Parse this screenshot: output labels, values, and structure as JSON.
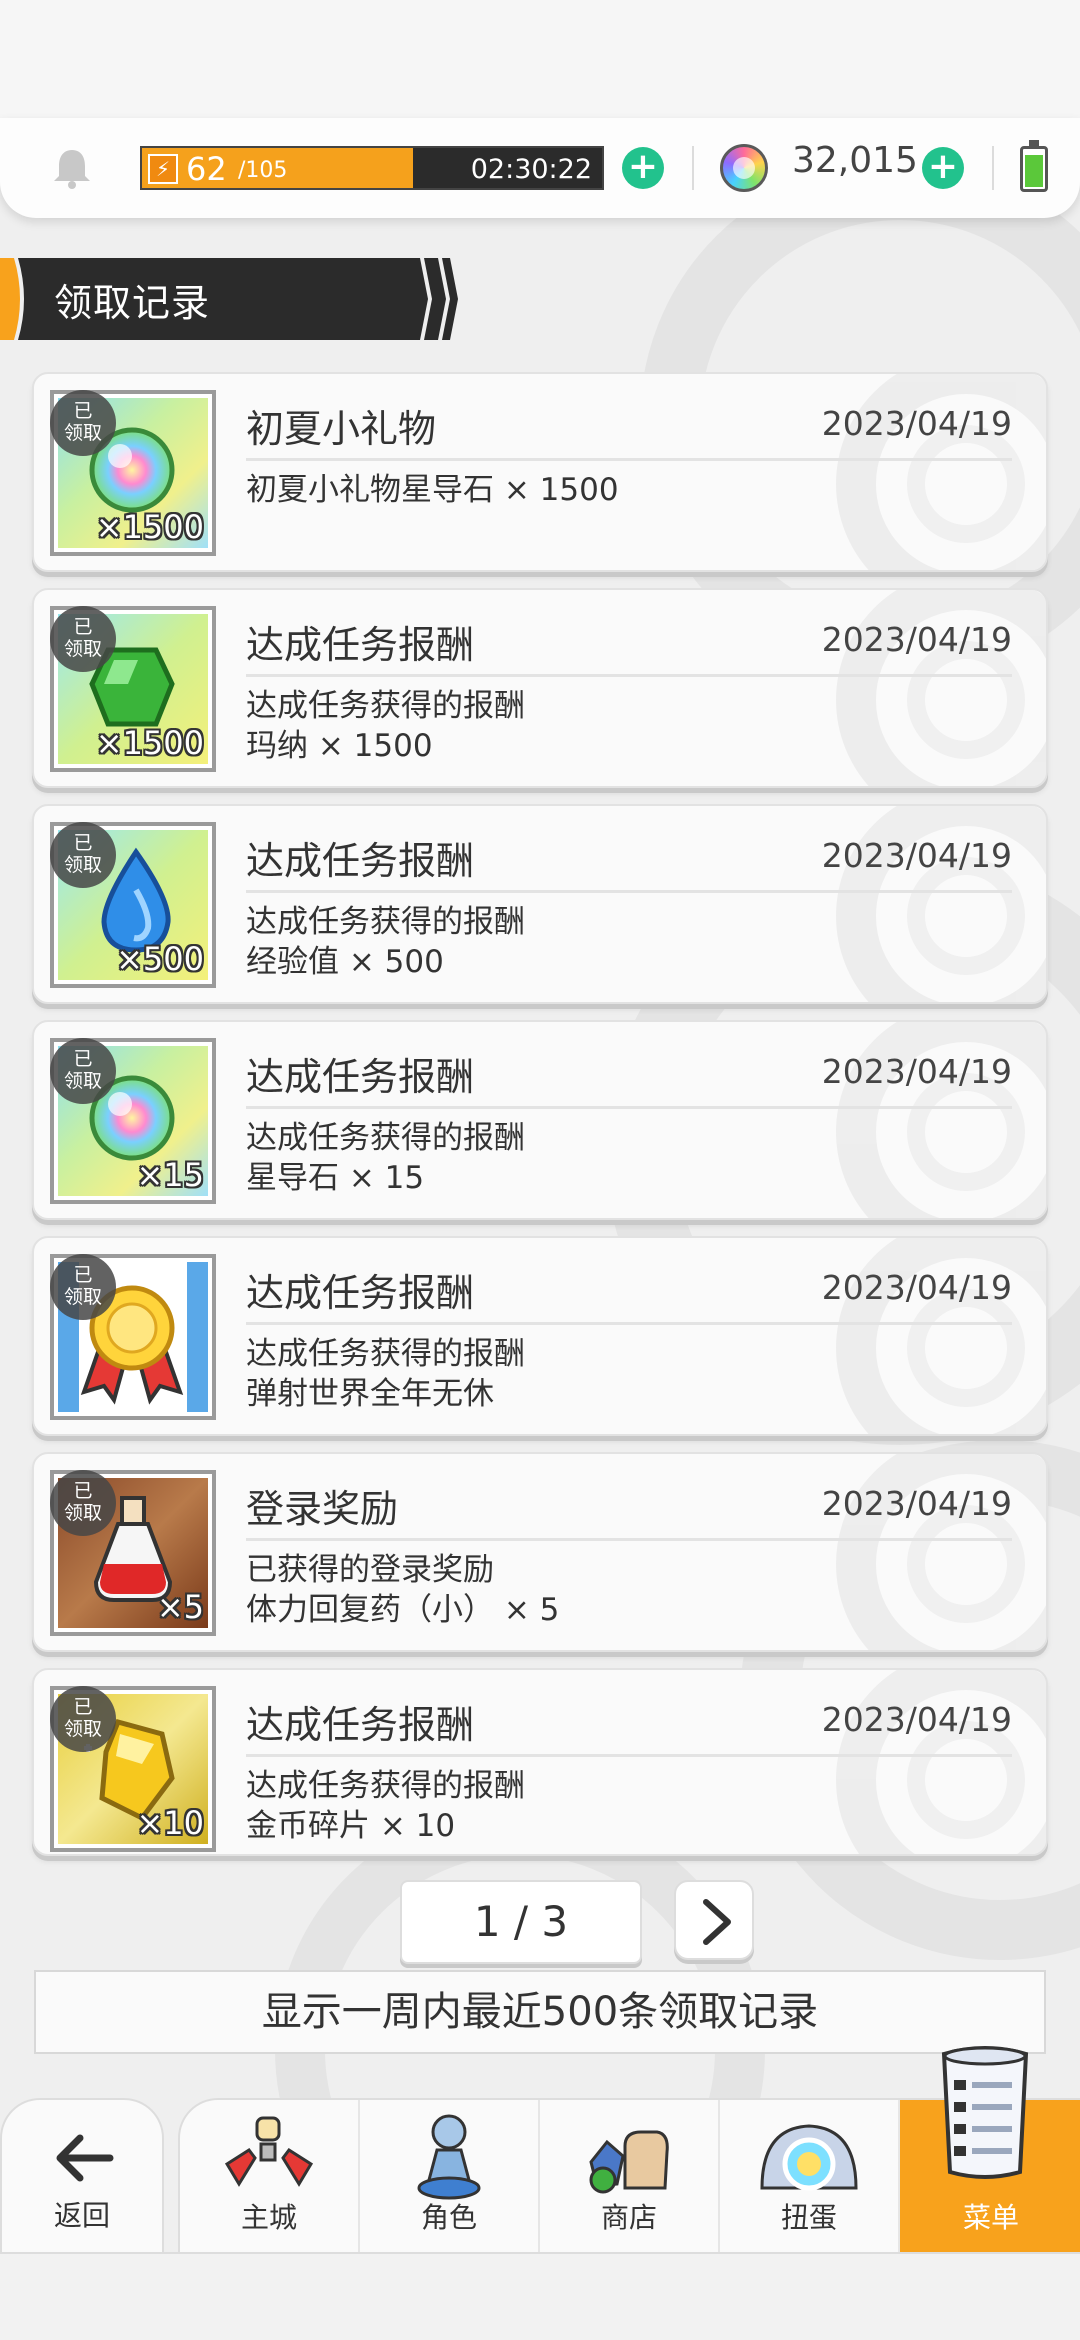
{
  "status_bar": {
    "stamina_current": "62",
    "stamina_max": "/105",
    "stamina_fraction": 0.59,
    "stamina_timer": "02:30:22",
    "gem_count": "32,015"
  },
  "section": {
    "title": "领取记录"
  },
  "records": [
    {
      "title": "初夏小礼物",
      "date": "2023/04/19",
      "desc1": "初夏小礼物星导石 × 1500",
      "desc2": "",
      "qty": "×1500",
      "badge_line1": "已",
      "badge_line2": "领取",
      "icon": "rainbow-orb-icon"
    },
    {
      "title": "达成任务报酬",
      "date": "2023/04/19",
      "desc1": "达成任务获得的报酬",
      "desc2": "玛纳 × 1500",
      "qty": "×1500",
      "badge_line1": "已",
      "badge_line2": "领取",
      "icon": "green-gem-icon"
    },
    {
      "title": "达成任务报酬",
      "date": "2023/04/19",
      "desc1": "达成任务获得的报酬",
      "desc2": "经验值 × 500",
      "qty": "×500",
      "badge_line1": "已",
      "badge_line2": "领取",
      "icon": "blue-drop-icon"
    },
    {
      "title": "达成任务报酬",
      "date": "2023/04/19",
      "desc1": "达成任务获得的报酬",
      "desc2": "星导石 × 15",
      "qty": "×15",
      "badge_line1": "已",
      "badge_line2": "领取",
      "icon": "rainbow-orb-icon"
    },
    {
      "title": "达成任务报酬",
      "date": "2023/04/19",
      "desc1": "达成任务获得的报酬",
      "desc2": "弹射世界全年无休",
      "qty": "",
      "badge_line1": "已",
      "badge_line2": "领取",
      "icon": "medal-icon"
    },
    {
      "title": "登录奖励",
      "date": "2023/04/19",
      "desc1": "已获得的登录奖励",
      "desc2": "体力回复药（小） × 5",
      "qty": "×5",
      "badge_line1": "已",
      "badge_line2": "领取",
      "icon": "potion-icon"
    },
    {
      "title": "达成任务报酬",
      "date": "2023/04/19",
      "desc1": "达成任务获得的报酬",
      "desc2": "金币碎片 × 10",
      "qty": "×10",
      "badge_line1": "已",
      "badge_line2": "领取",
      "icon": "coin-shard-icon"
    }
  ],
  "pagination": {
    "label": "1 / 3"
  },
  "notice": "显示一周内最近500条领取记录",
  "nav": {
    "back_label": "返回",
    "items": [
      {
        "label": "主城",
        "icon": "castle-icon"
      },
      {
        "label": "角色",
        "icon": "character-icon"
      },
      {
        "label": "商店",
        "icon": "shop-icon"
      },
      {
        "label": "扭蛋",
        "icon": "gacha-icon"
      },
      {
        "label": "菜单",
        "icon": "menu-list-icon"
      }
    ],
    "active_index": 4
  },
  "colors": {
    "accent": "#f8a21c",
    "plus": "#22c28d",
    "header_dark": "#2b2b2b"
  }
}
